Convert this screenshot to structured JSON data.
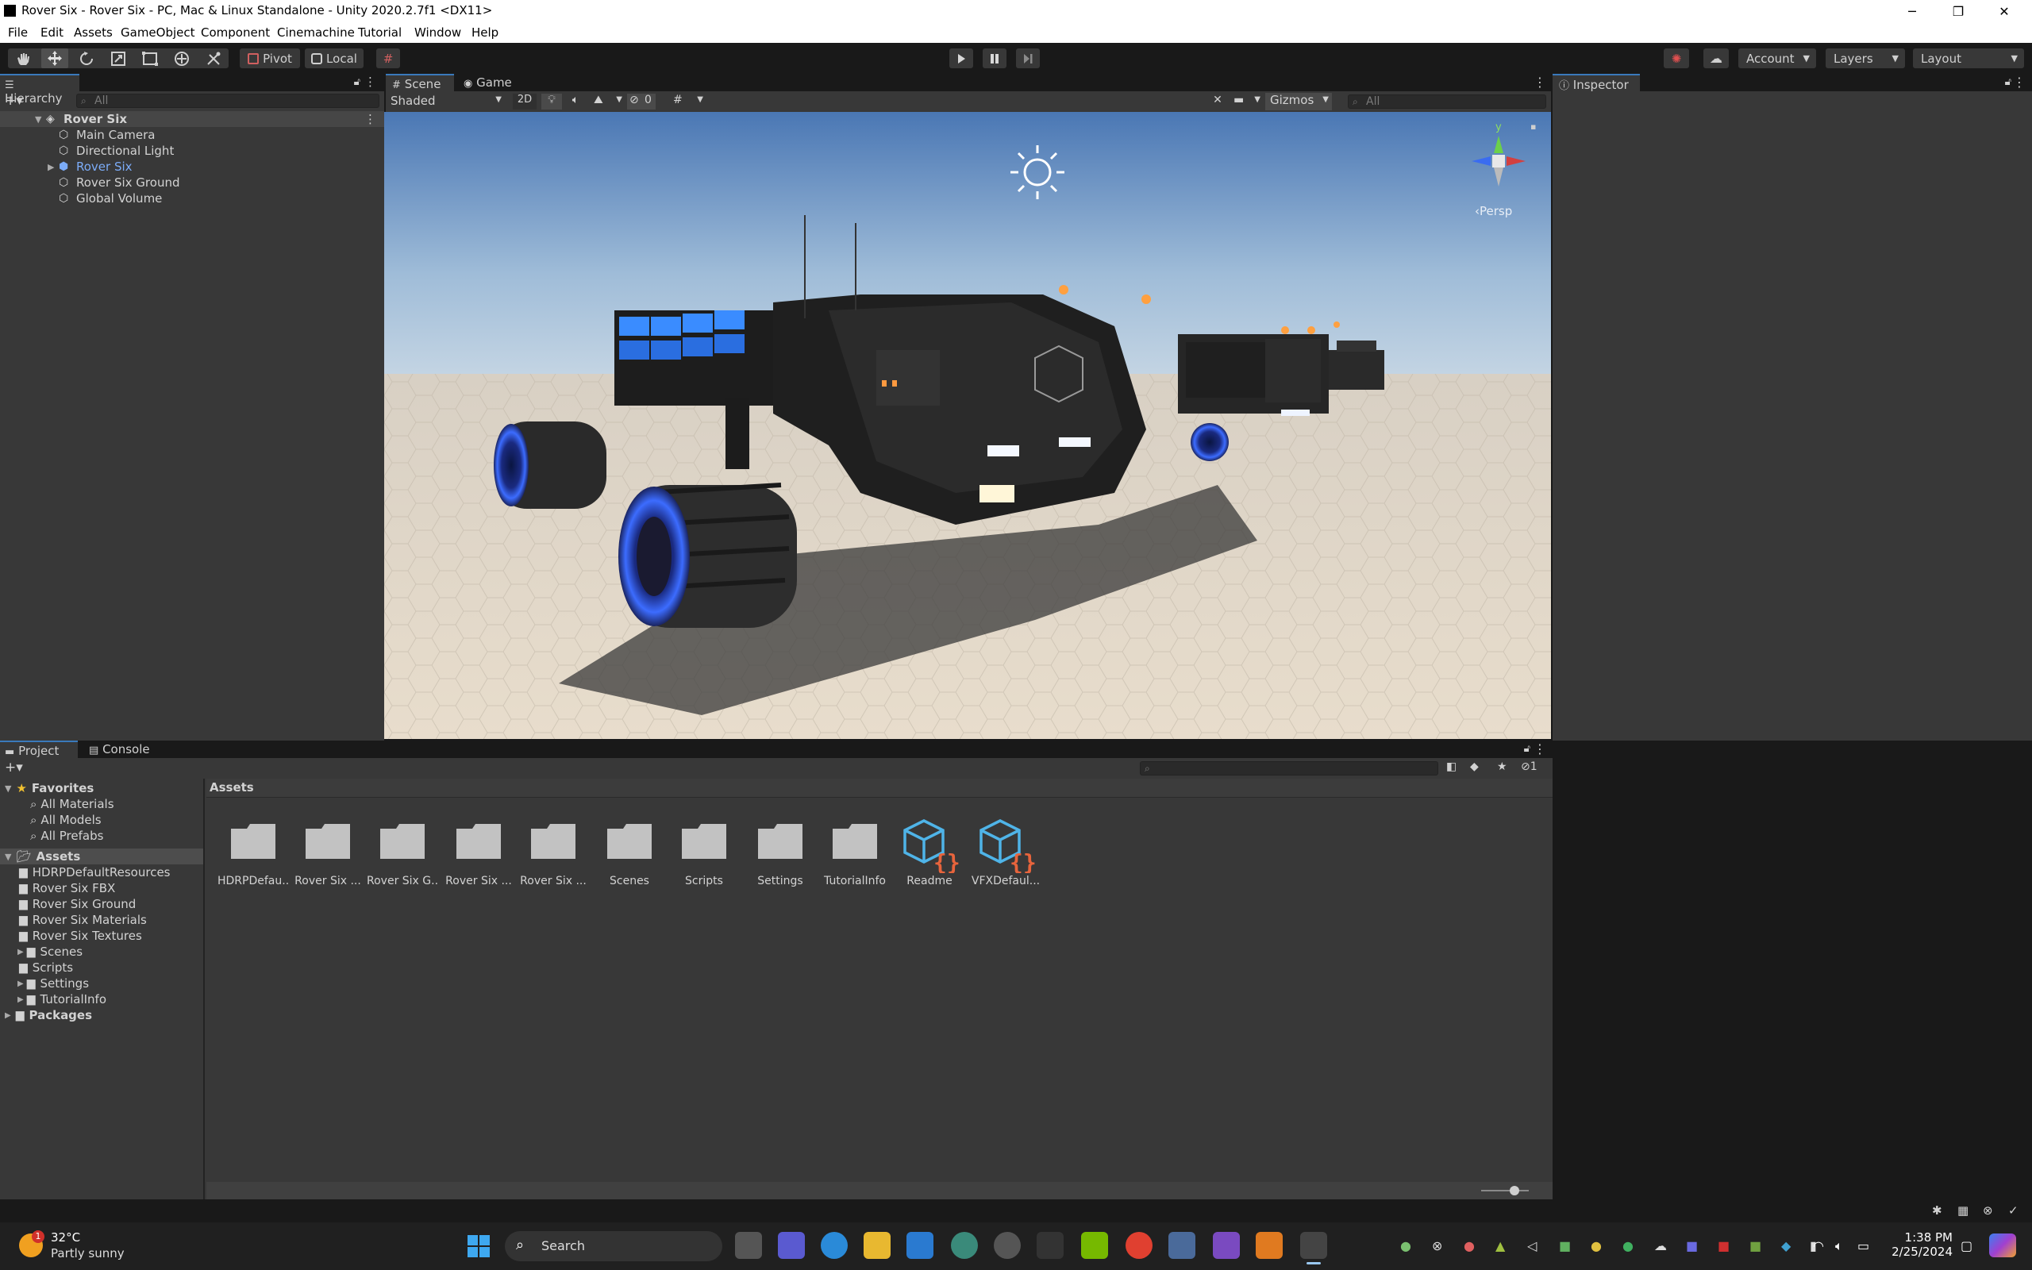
{
  "window": {
    "title": "Rover Six - Rover Six - PC, Mac & Linux Standalone - Unity 2020.2.7f1 <DX11>",
    "controls": [
      "─",
      "❐",
      "✕"
    ]
  },
  "menu": [
    "File",
    "Edit",
    "Assets",
    "GameObject",
    "Component",
    "Cinemachine",
    "Tutorial",
    "Window",
    "Help"
  ],
  "toolbar": {
    "pivot_label": "Pivot",
    "local_label": "Local",
    "account_label": "Account",
    "layers_label": "Layers",
    "layout_label": "Layout"
  },
  "hierarchy": {
    "tab_label": "Hierarchy",
    "search_placeholder": "All",
    "scene_name": "Rover Six",
    "items": [
      {
        "label": "Main Camera",
        "depth": 1,
        "expandable": false,
        "prefab": false
      },
      {
        "label": "Directional Light",
        "depth": 1,
        "expandable": false,
        "prefab": false
      },
      {
        "label": "Rover Six",
        "depth": 1,
        "expandable": true,
        "prefab": true
      },
      {
        "label": "Rover Six Ground",
        "depth": 1,
        "expandable": false,
        "prefab": false
      },
      {
        "label": "Global Volume",
        "depth": 1,
        "expandable": false,
        "prefab": false
      }
    ]
  },
  "scene": {
    "tabs": [
      "Scene",
      "Game"
    ],
    "shading_mode": "Shaded",
    "mode_2d": "2D",
    "hidden_count": "0",
    "gizmos_label": "Gizmos",
    "search_placeholder": "All",
    "gizmo_axis_label": "y",
    "projection_label": "‹Persp"
  },
  "inspector": {
    "tab_label": "Inspector"
  },
  "project": {
    "tabs": [
      "Project",
      "Console"
    ],
    "breadcrumb": "Assets",
    "hidden_packages_count": "1",
    "favorites_label": "Favorites",
    "favorites": [
      "All Materials",
      "All Models",
      "All Prefabs"
    ],
    "assets_root": "Assets",
    "asset_tree": [
      {
        "label": "HDRPDefaultResources",
        "expandable": false
      },
      {
        "label": "Rover Six FBX",
        "expandable": false
      },
      {
        "label": "Rover Six Ground",
        "expandable": false
      },
      {
        "label": "Rover Six Materials",
        "expandable": false
      },
      {
        "label": "Rover Six Textures",
        "expandable": false
      },
      {
        "label": "Scenes",
        "expandable": true
      },
      {
        "label": "Scripts",
        "expandable": false
      },
      {
        "label": "Settings",
        "expandable": true
      },
      {
        "label": "TutorialInfo",
        "expandable": true
      }
    ],
    "packages_label": "Packages",
    "assets": [
      {
        "label": "HDRPDefau...",
        "type": "folder"
      },
      {
        "label": "Rover Six ...",
        "type": "folder"
      },
      {
        "label": "Rover Six G...",
        "type": "folder"
      },
      {
        "label": "Rover Six ...",
        "type": "folder"
      },
      {
        "label": "Rover Six ...",
        "type": "folder"
      },
      {
        "label": "Scenes",
        "type": "folder"
      },
      {
        "label": "Scripts",
        "type": "folder"
      },
      {
        "label": "Settings",
        "type": "folder"
      },
      {
        "label": "TutorialInfo",
        "type": "folder"
      },
      {
        "label": "Readme",
        "type": "script-asset"
      },
      {
        "label": "VFXDefaul...",
        "type": "script-asset"
      }
    ]
  },
  "taskbar": {
    "weather_temp": "32°C",
    "weather_desc": "Partly sunny",
    "weather_badge": "1",
    "search_label": "Search",
    "time": "1:38 PM",
    "date": "2/25/2024"
  },
  "colors": {
    "accent": "#3a79bb",
    "panel_bg": "#383838",
    "dark_bg": "#191919",
    "prefab_blue": "#7cacf8",
    "folder_grey": "#c2c2c2",
    "script_icon_blue": "#4fb4e8",
    "script_icon_orange": "#e8643c"
  }
}
